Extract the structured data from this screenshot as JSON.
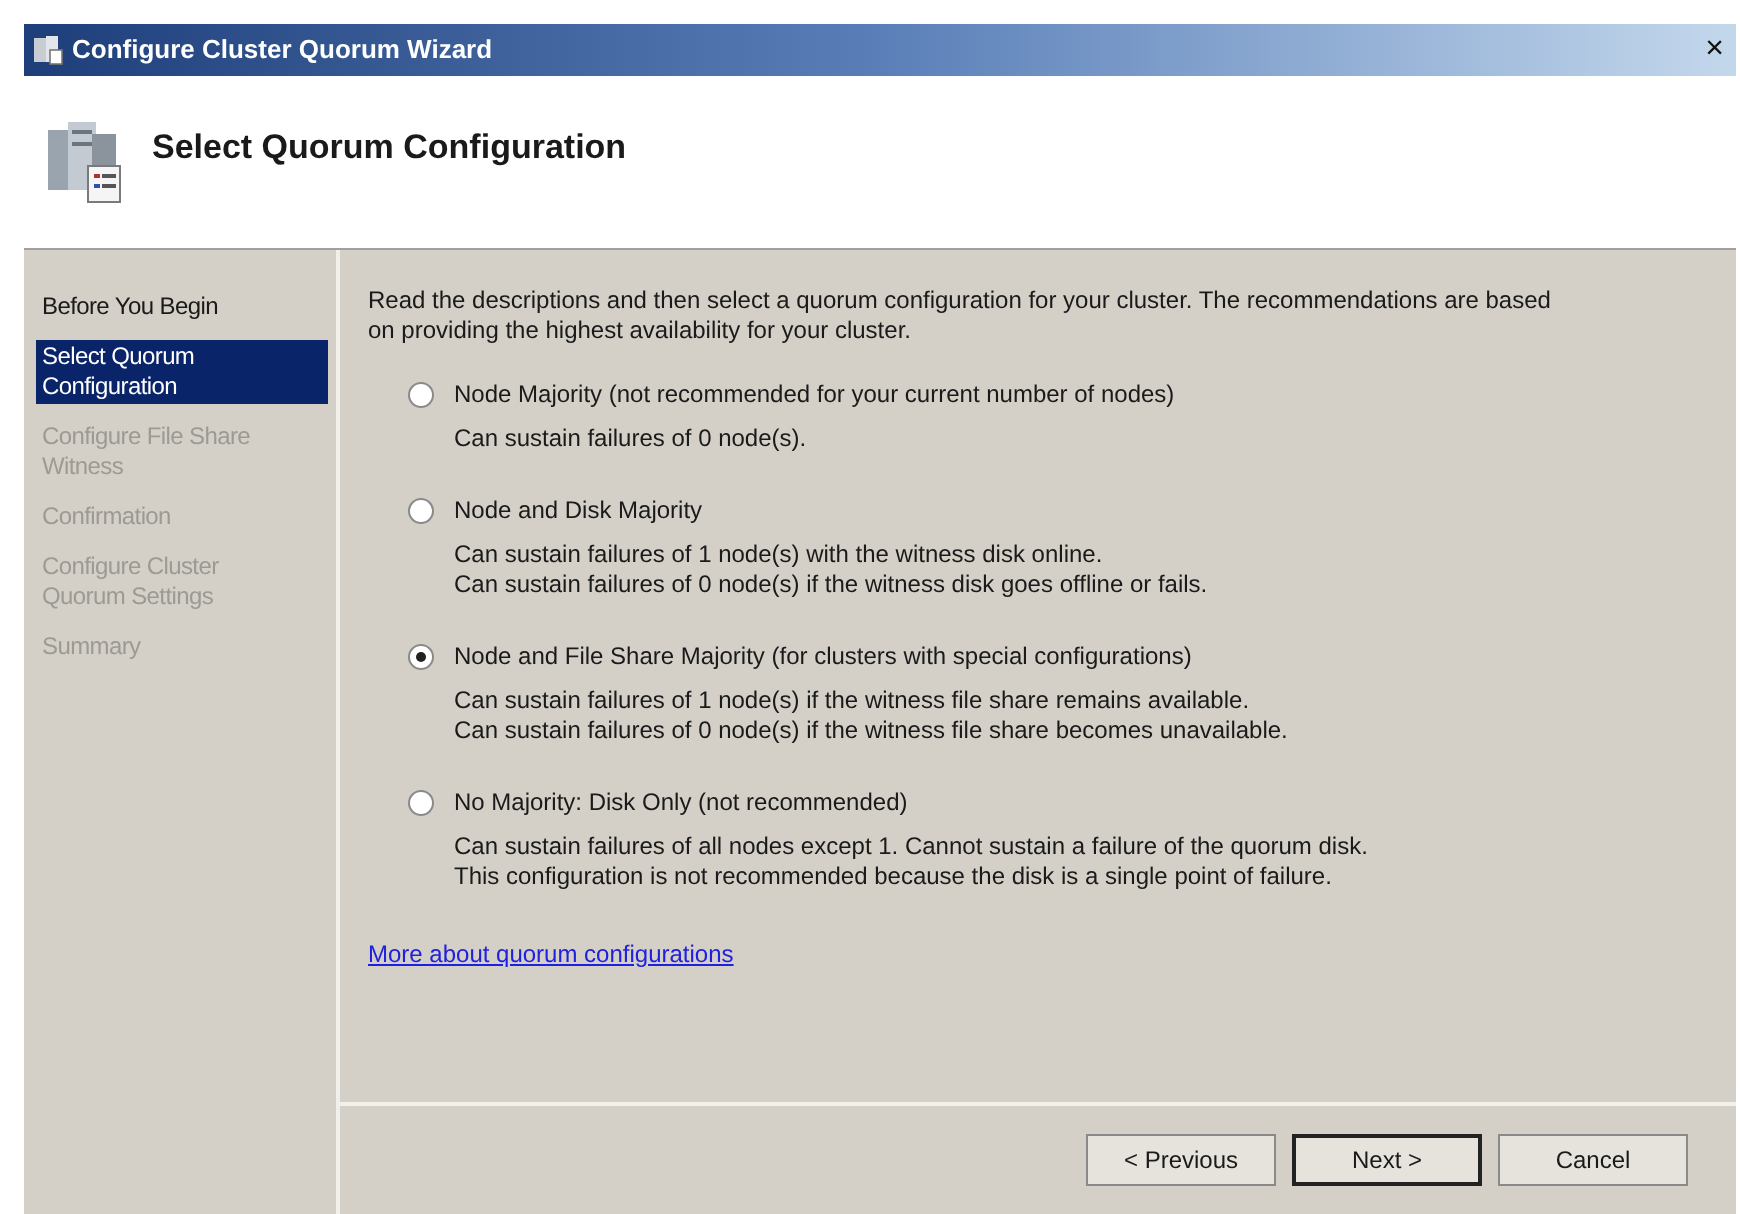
{
  "window": {
    "title": "Configure Cluster Quorum Wizard",
    "close": "×"
  },
  "header": {
    "title": "Select Quorum Configuration"
  },
  "sidebar": {
    "items": [
      {
        "label": "Before You Begin",
        "selected": false,
        "disabled": false
      },
      {
        "label": "Select Quorum Configuration",
        "selected": true,
        "disabled": false
      },
      {
        "label": "Configure File Share Witness",
        "selected": false,
        "disabled": true
      },
      {
        "label": "Confirmation",
        "selected": false,
        "disabled": true
      },
      {
        "label": "Configure Cluster Quorum Settings",
        "selected": false,
        "disabled": true
      },
      {
        "label": "Summary",
        "selected": false,
        "disabled": true
      }
    ]
  },
  "intro": "Read the descriptions and then select a quorum configuration for your cluster. The recommendations are based on providing the highest availability for your cluster.",
  "options": [
    {
      "label": "Node Majority (not recommended for your current number of nodes)",
      "selected": false,
      "descriptions": [
        "Can sustain failures of 0 node(s)."
      ]
    },
    {
      "label": "Node and Disk Majority",
      "selected": false,
      "descriptions": [
        "Can sustain failures of 1 node(s) with the witness disk online.",
        "Can sustain failures of 0 node(s) if the witness disk goes offline or fails."
      ]
    },
    {
      "label": "Node and File Share Majority (for clusters with special configurations)",
      "selected": true,
      "descriptions": [
        "Can sustain failures of 1 node(s) if the witness file share remains available.",
        "Can sustain failures of 0 node(s) if the witness file share becomes unavailable."
      ]
    },
    {
      "label": "No Majority: Disk Only (not recommended)",
      "selected": false,
      "descriptions": [
        "Can sustain failures of all nodes except 1. Cannot sustain a failure of the quorum disk. This configuration is not recommended because the disk is a single point of failure."
      ]
    }
  ],
  "link": "More about quorum configurations",
  "buttons": [
    {
      "label": "< Previous",
      "default": false
    },
    {
      "label": "Next >",
      "default": true
    },
    {
      "label": "Cancel",
      "default": false
    }
  ]
}
